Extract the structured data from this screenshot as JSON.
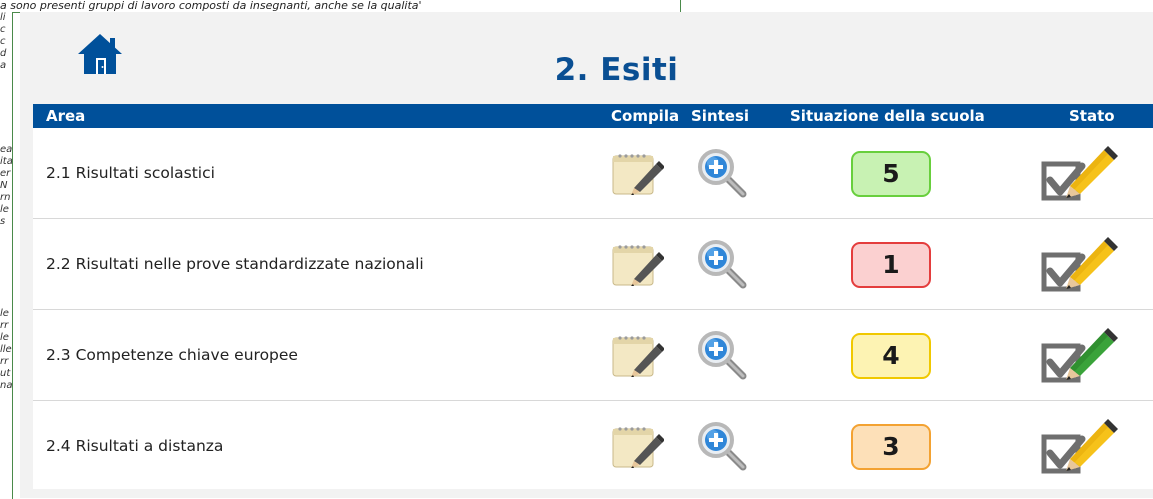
{
  "background": {
    "top_text": "a sono presenti gruppi di lavoro composti da insegnanti, anche se la qualita'",
    "gutter_blocks": [
      [
        "li",
        "c",
        "c",
        "d",
        "a"
      ],
      [
        "ea",
        "ita",
        "er",
        "N",
        "rn",
        "le",
        "s"
      ],
      [
        "le",
        "rr",
        "le",
        "lle",
        "rr",
        "ut",
        "na"
      ]
    ]
  },
  "modal": {
    "title": "2. Esiti",
    "home_icon": "home-icon",
    "columns": {
      "area": "Area",
      "compila": "Compila",
      "sintesi": "Sintesi",
      "situazione": "Situazione della scuola",
      "stato": "Stato"
    },
    "rows": [
      {
        "label": "2.1  Risultati scolastici",
        "score": "5",
        "score_color": "green",
        "stato_icon": "check-pencil-yellow-icon"
      },
      {
        "label": "2.2  Risultati nelle prove standardizzate nazionali",
        "score": "1",
        "score_color": "red",
        "stato_icon": "check-pencil-yellow-icon"
      },
      {
        "label": "2.3  Competenze chiave europee",
        "score": "4",
        "score_color": "yellow",
        "stato_icon": "check-pencil-green-icon"
      },
      {
        "label": "2.4  Risultati a distanza",
        "score": "3",
        "score_color": "orange",
        "stato_icon": "check-pencil-yellow-icon"
      }
    ]
  },
  "colors": {
    "header_bg": "#00509a",
    "title": "#0a4f93",
    "green": {
      "fill": "#c8f2b3",
      "border": "#68cf3d"
    },
    "red": {
      "fill": "#fbd0d0",
      "border": "#e43d3d"
    },
    "yellow": {
      "fill": "#fdf3b3",
      "border": "#f0c800"
    },
    "orange": {
      "fill": "#fde0b8",
      "border": "#f3a232"
    }
  }
}
